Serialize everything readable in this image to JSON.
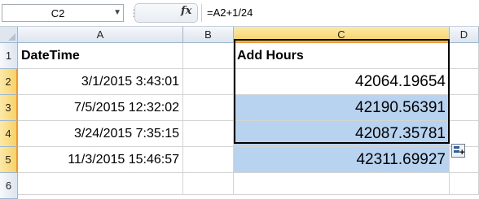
{
  "formula_bar": {
    "name_box": "C2",
    "fx_label": "fx",
    "formula": "=A2+1/24"
  },
  "columns": [
    "A",
    "B",
    "C",
    "D"
  ],
  "rows": [
    "1",
    "2",
    "3",
    "4",
    "5",
    "6"
  ],
  "cells": {
    "A1": "DateTime",
    "C1": "Add Hours",
    "A2": "3/1/2015 3:43:01",
    "A3": "7/5/2015 12:32:02",
    "A4": "3/24/2015 7:35:15",
    "A5": "11/3/2015 15:46:57",
    "C2": "42064.19654",
    "C3": "42190.56391",
    "C4": "42087.35781",
    "C5": "42311.69927"
  },
  "colors": {
    "selection_fill": "#b8d3ef",
    "header_highlight": "#f7d266",
    "header_highlight_border": "#f29536"
  }
}
